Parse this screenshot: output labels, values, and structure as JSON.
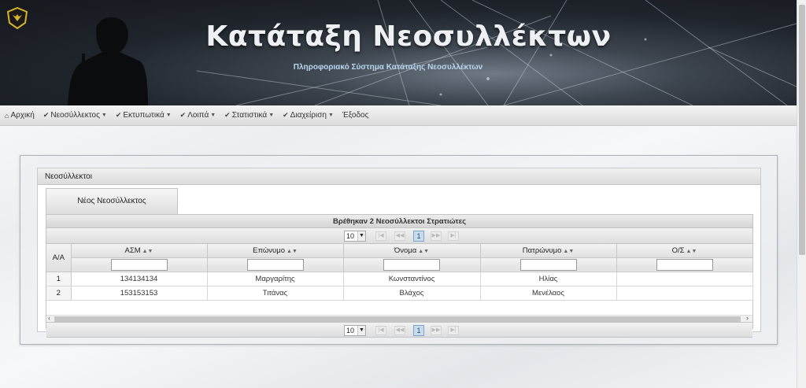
{
  "header": {
    "title": "Κατάταξη Νεοσυλλέκτων",
    "subtitle": "Πληροφοριακό Σύστημα Κατάταξης Νεοσυλλέκτων"
  },
  "nav": {
    "items": [
      {
        "label": "Αρχική",
        "icon": "home-icon",
        "caret": false
      },
      {
        "label": "Νεοσύλλεκτος",
        "icon": "check-icon",
        "caret": true
      },
      {
        "label": "Εκτυπωτικά",
        "icon": "check-icon",
        "caret": true
      },
      {
        "label": "Λοιπά",
        "icon": "check-icon",
        "caret": true
      },
      {
        "label": "Στατιστικά",
        "icon": "check-icon",
        "caret": true
      },
      {
        "label": "Διαχείριση",
        "icon": "check-icon",
        "caret": true
      },
      {
        "label": "Έξοδος",
        "icon": "",
        "caret": false
      }
    ]
  },
  "panel": {
    "title": "Νεοσύλλεκτοι",
    "new_button": "Νέος Νεοσύλλεκτος"
  },
  "grid": {
    "caption": "Βρέθηκαν 2 Νεοσύλλεκτοι Στρατιώτες",
    "rows_per_page": "10",
    "current_page": "1",
    "columns": {
      "rownum": "Α/Α",
      "asm": "ΑΣΜ",
      "surname": "Επώνυμο",
      "name": "Όνομα",
      "father": "Πατρώνυμο",
      "unit": "Ο/Σ"
    },
    "rows": [
      {
        "n": "1",
        "asm": "134134134",
        "surname": "Μαργαρίτης",
        "name": "Κωνσταντίνος",
        "father": "Ηλίας",
        "unit": ""
      },
      {
        "n": "2",
        "asm": "153153153",
        "surname": "Τιτάνας",
        "name": "Βλάχος",
        "father": "Μενέλαος",
        "unit": ""
      }
    ]
  },
  "colors": {
    "banner_dark": "#1f242b",
    "subtitle": "#b9d6ee",
    "active_page": "#c7dcef"
  }
}
